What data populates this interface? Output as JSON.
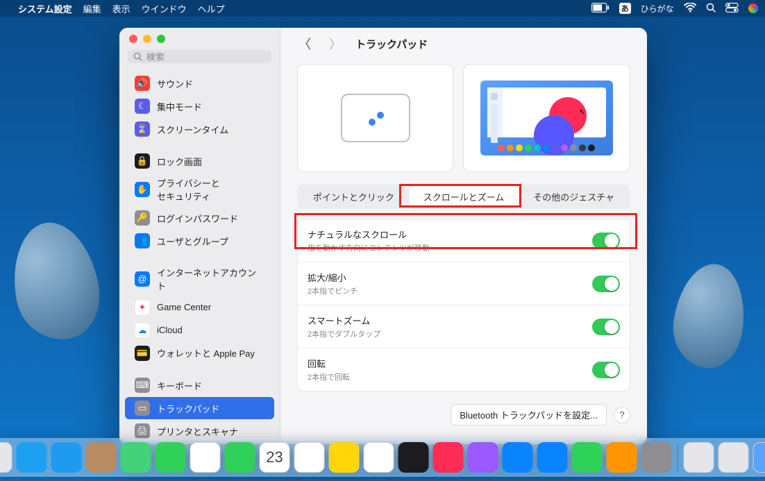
{
  "menubar": {
    "app": "システム設定",
    "items": [
      "編集",
      "表示",
      "ウインドウ",
      "ヘルプ"
    ],
    "input_mode": "あ",
    "input_label": "ひらがな"
  },
  "window": {
    "search_placeholder": "検索",
    "title": "トラックパッド"
  },
  "sidebar": {
    "items": [
      {
        "label": "サウンド",
        "icon": "sound-icon",
        "color": "#ff3b30"
      },
      {
        "label": "集中モード",
        "icon": "moon-icon",
        "color": "#5e5ce6"
      },
      {
        "label": "スクリーンタイム",
        "icon": "hourglass-icon",
        "color": "#5e5ce6"
      },
      {
        "label": "ロック画面",
        "icon": "lock-icon",
        "color": "#1c1c1e"
      },
      {
        "label": "プライバシーと\nセキュリティ",
        "icon": "hand-icon",
        "color": "#007aff"
      },
      {
        "label": "ログインパスワード",
        "icon": "key-icon",
        "color": "#8e8e93"
      },
      {
        "label": "ユーザとグループ",
        "icon": "users-icon",
        "color": "#007aff"
      },
      {
        "label": "インターネットアカウント",
        "icon": "at-icon",
        "color": "#007aff"
      },
      {
        "label": "Game Center",
        "icon": "gamecenter-icon",
        "color": "#ffffff"
      },
      {
        "label": "iCloud",
        "icon": "cloud-icon",
        "color": "#ffffff"
      },
      {
        "label": "ウォレットと Apple Pay",
        "icon": "wallet-icon",
        "color": "#1c1c1e"
      },
      {
        "label": "キーボード",
        "icon": "keyboard-icon",
        "color": "#8e8e93"
      },
      {
        "label": "トラックパッド",
        "icon": "trackpad-icon",
        "color": "#8e8e93",
        "selected": true
      },
      {
        "label": "プリンタとスキャナ",
        "icon": "printer-icon",
        "color": "#8e8e93"
      }
    ]
  },
  "tabs": {
    "point_click": "ポイントとクリック",
    "scroll_zoom": "スクロールとズーム",
    "more_gestures": "その他のジェスチャ",
    "active": "scroll_zoom"
  },
  "settings": {
    "natural_scroll": {
      "title": "ナチュラルなスクロール",
      "sub": "指を動かす方向にコンテンツが移動",
      "on": true
    },
    "pinch_zoom": {
      "title": "拡大/縮小",
      "sub": "2本指でピンチ",
      "on": true
    },
    "smart_zoom": {
      "title": "スマートズーム",
      "sub": "2本指でダブルタップ",
      "on": true
    },
    "rotate": {
      "title": "回転",
      "sub": "2本指で回転",
      "on": true
    }
  },
  "footer": {
    "bluetooth_btn": "Bluetooth トラックパッドを設定...",
    "help": "?"
  },
  "dock": {
    "items": [
      {
        "name": "finder",
        "color": "#1e9bf0"
      },
      {
        "name": "launchpad",
        "color": "#e5e5ea"
      },
      {
        "name": "safari",
        "color": "#1ea0f1"
      },
      {
        "name": "mail",
        "color": "#1e9bf0"
      },
      {
        "name": "contacts",
        "color": "#b88c63"
      },
      {
        "name": "maps",
        "color": "#43d17a"
      },
      {
        "name": "messages",
        "color": "#30d158"
      },
      {
        "name": "photos",
        "color": "#ffffff"
      },
      {
        "name": "facetime",
        "color": "#30d158"
      },
      {
        "name": "calendar",
        "color": "#ffffff",
        "text": "23"
      },
      {
        "name": "reminders",
        "color": "#ffffff"
      },
      {
        "name": "notes",
        "color": "#ffd60a"
      },
      {
        "name": "freeform",
        "color": "#ffffff"
      },
      {
        "name": "tv",
        "color": "#1c1c1e"
      },
      {
        "name": "music",
        "color": "#ff2d55"
      },
      {
        "name": "podcasts",
        "color": "#9b59ff"
      },
      {
        "name": "appstore",
        "color": "#0a84ff"
      },
      {
        "name": "keynote",
        "color": "#0a84ff"
      },
      {
        "name": "numbers",
        "color": "#30d158"
      },
      {
        "name": "pages",
        "color": "#ff9500"
      },
      {
        "name": "settings",
        "color": "#8e8e93"
      }
    ],
    "right": [
      {
        "name": "downloads",
        "color": "#e5e5ea"
      },
      {
        "name": "screenshot",
        "color": "#e5e5ea"
      },
      {
        "name": "folder",
        "color": "#5aa3ff"
      },
      {
        "name": "trash",
        "color": "#e5e5ea"
      }
    ]
  },
  "palette": [
    "#ff5f57",
    "#ff9500",
    "#ffd60a",
    "#30d158",
    "#00c7be",
    "#0a84ff",
    "#5e5ce6",
    "#bf5af2",
    "#8e8e93",
    "#3a3a3c",
    "#1c1c1e"
  ]
}
